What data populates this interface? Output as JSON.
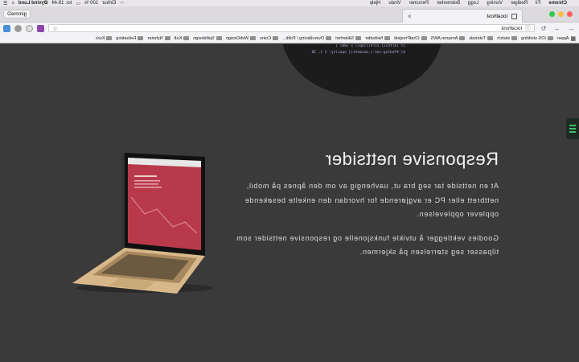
{
  "menubar": {
    "app": "Chrome",
    "items": [
      "Fil",
      "Rediger",
      "Visning",
      "Logg",
      "Bokmerker",
      "Personer",
      "Vindu",
      "Hjelp"
    ],
    "status": [
      "Eirikur",
      "100 %",
      "tor. 19.44",
      "Øyvind Lund"
    ]
  },
  "tab": {
    "title": "localhost"
  },
  "profile": {
    "label": "gimmeD"
  },
  "address": {
    "url": "localhost"
  },
  "bookmarks": [
    "Apper",
    "iOS utvikling",
    "sketch",
    "Tutorials",
    "Amazon AWS",
    "ChatProsjekt",
    "Nettsider",
    "Sikkerhet",
    "Overvåkning / Politi...",
    "Coins",
    "WebDesign",
    "Spilldesign",
    "Kult",
    "Nyheter",
    "Feilsøking",
    "Kurs"
  ],
  "code": {
    "line1": "if ($(this).scrollTop() > 180) {",
    "line2": "$('#fading-inn').animate({ opacity: 1 }, 20"
  },
  "hero": {
    "title": "Responsive nettsider",
    "paragraph1": "At en nettside tar seg bra ut, uavhengig av om den åpnes på mobil, nettbrett eller PC er avgjørende for hvordan den enkelte besøkende opplever opplevelsen.",
    "paragraph2": "Goodies vektlegger å utvikle funksjonelle og responsive nettsider som tilpasser seg størrelsen på skjermen."
  },
  "colors": {
    "background": "#3a3a3a",
    "accent_green": "#3ec06a",
    "laptop_gold": "#d8b88a",
    "laptop_screen": "#b83a4a"
  },
  "icons": {
    "side_menu": "hamburger-menu-icon",
    "laptop": "laptop-illustration"
  }
}
